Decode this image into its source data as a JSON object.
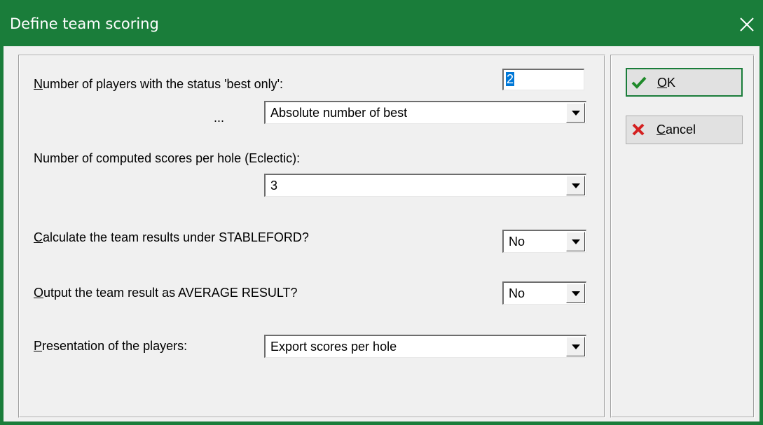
{
  "window": {
    "title": "Define team scoring"
  },
  "form": {
    "best_only": {
      "label_underline": "N",
      "label_rest": "umber of players with the status 'best only':",
      "value": "2",
      "ellipsis": "...",
      "mode_value": "Absolute number of best"
    },
    "eclectic": {
      "label": "Number of computed scores per hole (Eclectic):",
      "value": "3"
    },
    "stableford": {
      "label_underline": "C",
      "label_rest": "alculate the team results under STABLEFORD?",
      "value": "No"
    },
    "average": {
      "label_underline": "O",
      "label_rest": "utput the team result as AVERAGE RESULT?",
      "value": "No"
    },
    "presentation": {
      "label_underline": "P",
      "label_rest": "resentation of the players:",
      "value": "Export scores per hole"
    }
  },
  "buttons": {
    "ok": {
      "underline": "O",
      "rest": "K",
      "icon": "checkmark-icon"
    },
    "cancel": {
      "underline": "C",
      "rest": "ancel",
      "icon": "red-x-icon"
    }
  },
  "colors": {
    "titlebar": "#1a7d3a",
    "selection": "#0078d7"
  }
}
